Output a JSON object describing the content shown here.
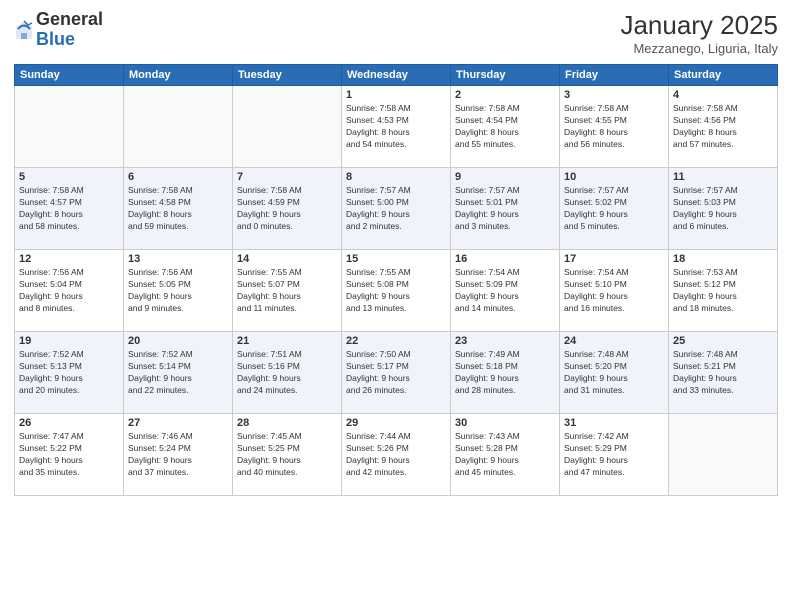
{
  "logo": {
    "general": "General",
    "blue": "Blue"
  },
  "title": "January 2025",
  "location": "Mezzanego, Liguria, Italy",
  "weekdays": [
    "Sunday",
    "Monday",
    "Tuesday",
    "Wednesday",
    "Thursday",
    "Friday",
    "Saturday"
  ],
  "weeks": [
    [
      {
        "day": "",
        "info": ""
      },
      {
        "day": "",
        "info": ""
      },
      {
        "day": "",
        "info": ""
      },
      {
        "day": "1",
        "info": "Sunrise: 7:58 AM\nSunset: 4:53 PM\nDaylight: 8 hours\nand 54 minutes."
      },
      {
        "day": "2",
        "info": "Sunrise: 7:58 AM\nSunset: 4:54 PM\nDaylight: 8 hours\nand 55 minutes."
      },
      {
        "day": "3",
        "info": "Sunrise: 7:58 AM\nSunset: 4:55 PM\nDaylight: 8 hours\nand 56 minutes."
      },
      {
        "day": "4",
        "info": "Sunrise: 7:58 AM\nSunset: 4:56 PM\nDaylight: 8 hours\nand 57 minutes."
      }
    ],
    [
      {
        "day": "5",
        "info": "Sunrise: 7:58 AM\nSunset: 4:57 PM\nDaylight: 8 hours\nand 58 minutes."
      },
      {
        "day": "6",
        "info": "Sunrise: 7:58 AM\nSunset: 4:58 PM\nDaylight: 8 hours\nand 59 minutes."
      },
      {
        "day": "7",
        "info": "Sunrise: 7:58 AM\nSunset: 4:59 PM\nDaylight: 9 hours\nand 0 minutes."
      },
      {
        "day": "8",
        "info": "Sunrise: 7:57 AM\nSunset: 5:00 PM\nDaylight: 9 hours\nand 2 minutes."
      },
      {
        "day": "9",
        "info": "Sunrise: 7:57 AM\nSunset: 5:01 PM\nDaylight: 9 hours\nand 3 minutes."
      },
      {
        "day": "10",
        "info": "Sunrise: 7:57 AM\nSunset: 5:02 PM\nDaylight: 9 hours\nand 5 minutes."
      },
      {
        "day": "11",
        "info": "Sunrise: 7:57 AM\nSunset: 5:03 PM\nDaylight: 9 hours\nand 6 minutes."
      }
    ],
    [
      {
        "day": "12",
        "info": "Sunrise: 7:56 AM\nSunset: 5:04 PM\nDaylight: 9 hours\nand 8 minutes."
      },
      {
        "day": "13",
        "info": "Sunrise: 7:56 AM\nSunset: 5:05 PM\nDaylight: 9 hours\nand 9 minutes."
      },
      {
        "day": "14",
        "info": "Sunrise: 7:55 AM\nSunset: 5:07 PM\nDaylight: 9 hours\nand 11 minutes."
      },
      {
        "day": "15",
        "info": "Sunrise: 7:55 AM\nSunset: 5:08 PM\nDaylight: 9 hours\nand 13 minutes."
      },
      {
        "day": "16",
        "info": "Sunrise: 7:54 AM\nSunset: 5:09 PM\nDaylight: 9 hours\nand 14 minutes."
      },
      {
        "day": "17",
        "info": "Sunrise: 7:54 AM\nSunset: 5:10 PM\nDaylight: 9 hours\nand 16 minutes."
      },
      {
        "day": "18",
        "info": "Sunrise: 7:53 AM\nSunset: 5:12 PM\nDaylight: 9 hours\nand 18 minutes."
      }
    ],
    [
      {
        "day": "19",
        "info": "Sunrise: 7:52 AM\nSunset: 5:13 PM\nDaylight: 9 hours\nand 20 minutes."
      },
      {
        "day": "20",
        "info": "Sunrise: 7:52 AM\nSunset: 5:14 PM\nDaylight: 9 hours\nand 22 minutes."
      },
      {
        "day": "21",
        "info": "Sunrise: 7:51 AM\nSunset: 5:16 PM\nDaylight: 9 hours\nand 24 minutes."
      },
      {
        "day": "22",
        "info": "Sunrise: 7:50 AM\nSunset: 5:17 PM\nDaylight: 9 hours\nand 26 minutes."
      },
      {
        "day": "23",
        "info": "Sunrise: 7:49 AM\nSunset: 5:18 PM\nDaylight: 9 hours\nand 28 minutes."
      },
      {
        "day": "24",
        "info": "Sunrise: 7:48 AM\nSunset: 5:20 PM\nDaylight: 9 hours\nand 31 minutes."
      },
      {
        "day": "25",
        "info": "Sunrise: 7:48 AM\nSunset: 5:21 PM\nDaylight: 9 hours\nand 33 minutes."
      }
    ],
    [
      {
        "day": "26",
        "info": "Sunrise: 7:47 AM\nSunset: 5:22 PM\nDaylight: 9 hours\nand 35 minutes."
      },
      {
        "day": "27",
        "info": "Sunrise: 7:46 AM\nSunset: 5:24 PM\nDaylight: 9 hours\nand 37 minutes."
      },
      {
        "day": "28",
        "info": "Sunrise: 7:45 AM\nSunset: 5:25 PM\nDaylight: 9 hours\nand 40 minutes."
      },
      {
        "day": "29",
        "info": "Sunrise: 7:44 AM\nSunset: 5:26 PM\nDaylight: 9 hours\nand 42 minutes."
      },
      {
        "day": "30",
        "info": "Sunrise: 7:43 AM\nSunset: 5:28 PM\nDaylight: 9 hours\nand 45 minutes."
      },
      {
        "day": "31",
        "info": "Sunrise: 7:42 AM\nSunset: 5:29 PM\nDaylight: 9 hours\nand 47 minutes."
      },
      {
        "day": "",
        "info": ""
      }
    ]
  ]
}
